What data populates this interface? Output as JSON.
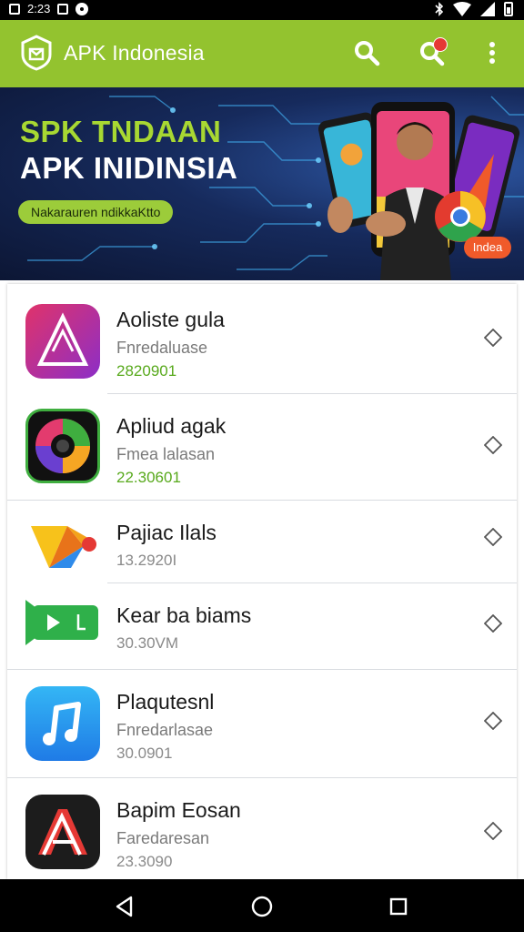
{
  "status_bar": {
    "time": "2:23"
  },
  "app_bar": {
    "title": "APK Indonesia",
    "accent": "#93c32f",
    "icons": [
      "shield-logo-icon",
      "search-icon",
      "search-notification-icon",
      "more-vert-icon"
    ]
  },
  "banner": {
    "line1": "SPK TNDAAN",
    "line2": "APK INIDINSIA",
    "pill": "Nakarauren ndikkaKtto",
    "tag": "Indea"
  },
  "apps": [
    {
      "name": "Aoliste gula",
      "sub": "Fnredaluase",
      "num": "2820901",
      "icon": "triangle-app-icon"
    },
    {
      "name": "Apliud agak",
      "sub": "Fmea lalasan",
      "num": "22.30601",
      "icon": "lens-app-icon"
    },
    {
      "name": "Pajiac Ilals",
      "sub": "",
      "num": "13.2920I",
      "icon": "play-games-icon"
    },
    {
      "name": "Kear ba biams",
      "sub": "",
      "num": "30.30VM",
      "icon": "video-play-icon"
    },
    {
      "name": "Plaqutesnl",
      "sub": "Fnredarlasae",
      "num": "30.0901",
      "icon": "music-note-icon"
    },
    {
      "name": "Bapim Eosan",
      "sub": "Faredaresan",
      "num": "23.3090",
      "icon": "letter-a-app-icon"
    }
  ]
}
